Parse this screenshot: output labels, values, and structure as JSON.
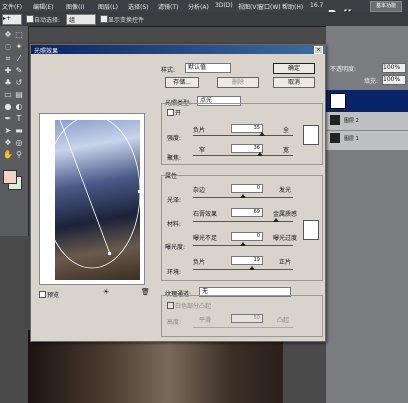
{
  "menubar": {
    "items": [
      "文件(F)",
      "编辑(E)",
      "图像(I)",
      "图层(L)",
      "选择(S)",
      "滤镜(T)",
      "分析(A)",
      "3D(D)",
      "视图(V)",
      "窗口(W)",
      "帮助(H)"
    ],
    "zoom": "16.7",
    "title_button": "基本功能"
  },
  "watermark": "www.Psjia.com",
  "options": {
    "auto_select_label": "自动选择:",
    "auto_select_value": "组",
    "show_transform_label": "显示变换控件",
    "opacity_label": "不透明度:",
    "opacity_value": "100%",
    "fill_label": "填充:",
    "fill_value": "100%"
  },
  "layers": [
    {
      "name": "图层 2"
    },
    {
      "name": "图层 1"
    }
  ],
  "dialog": {
    "title": "光照效果",
    "close_glyph": "×",
    "style_label": "样式:",
    "style_value": "默认值",
    "save_button": "存储...",
    "delete_button": "删除",
    "ok_button": "确定",
    "cancel_button": "取消",
    "light_type_label": "光照类型:",
    "light_type_value": "点光",
    "on_label": "开",
    "intensity_label": "强度:",
    "intensity_left": "负片",
    "intensity_right": "全",
    "intensity_value": "35",
    "focus_label": "聚焦:",
    "focus_left": "窄",
    "focus_right": "宽",
    "focus_value": "36",
    "properties_label": "属性",
    "gloss_label": "光泽:",
    "gloss_left": "杂边",
    "gloss_right": "发光",
    "gloss_value": "0",
    "material_label": "材料:",
    "material_left": "石膏效果",
    "material_right": "金属质感",
    "material_value": "69",
    "exposure_label": "曝光度:",
    "exposure_left": "曝光不足",
    "exposure_right": "曝光过度",
    "exposure_value": "0",
    "ambience_label": "环境:",
    "ambience_left": "负片",
    "ambience_right": "正片",
    "ambience_value": "19",
    "texture_label": "纹理通道:",
    "texture_value": "无",
    "white_high_label": "白色部分凸起",
    "height_label": "高度:",
    "height_left": "平滑",
    "height_right": "凸起",
    "height_value": "50",
    "preview_label": "预览",
    "bulb_glyph": "☀",
    "trash_glyph": "🗑"
  }
}
